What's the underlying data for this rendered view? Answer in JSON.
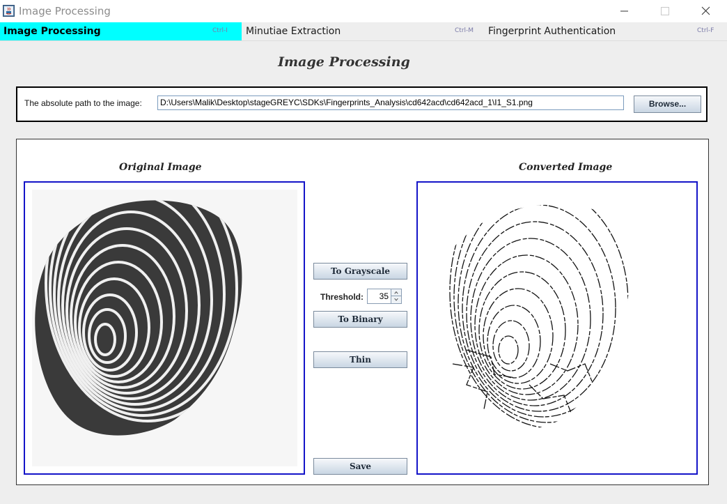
{
  "window": {
    "title": "Image Processing",
    "icon": "java-app-icon"
  },
  "menu": {
    "tabs": [
      {
        "label": "Image Processing",
        "accel": "Ctrl-I",
        "active": true
      },
      {
        "label": "Minutiae Extraction",
        "accel": "Ctrl-M",
        "active": false
      },
      {
        "label": "Fingerprint Authentication",
        "accel": "Ctrl-F",
        "active": false
      }
    ]
  },
  "page": {
    "heading": "Image Processing"
  },
  "path": {
    "label": "The absolute path to the image:",
    "value": "D:\\Users\\Malik\\Desktop\\stageGREYC\\SDKs\\Fingerprints_Analysis\\cd642acd\\cd642acd_1\\I1_S1.png",
    "browse_label": "Browse..."
  },
  "images": {
    "original_title": "Original Image",
    "converted_title": "Converted Image"
  },
  "controls": {
    "grayscale_label": "To Grayscale",
    "threshold_label": "Threshold:",
    "threshold_value": "35",
    "binary_label": "To Binary",
    "thin_label": "Thin",
    "save_label": "Save"
  },
  "colors": {
    "active_tab": "#00ffff",
    "image_frame_border": "#1414c8"
  }
}
